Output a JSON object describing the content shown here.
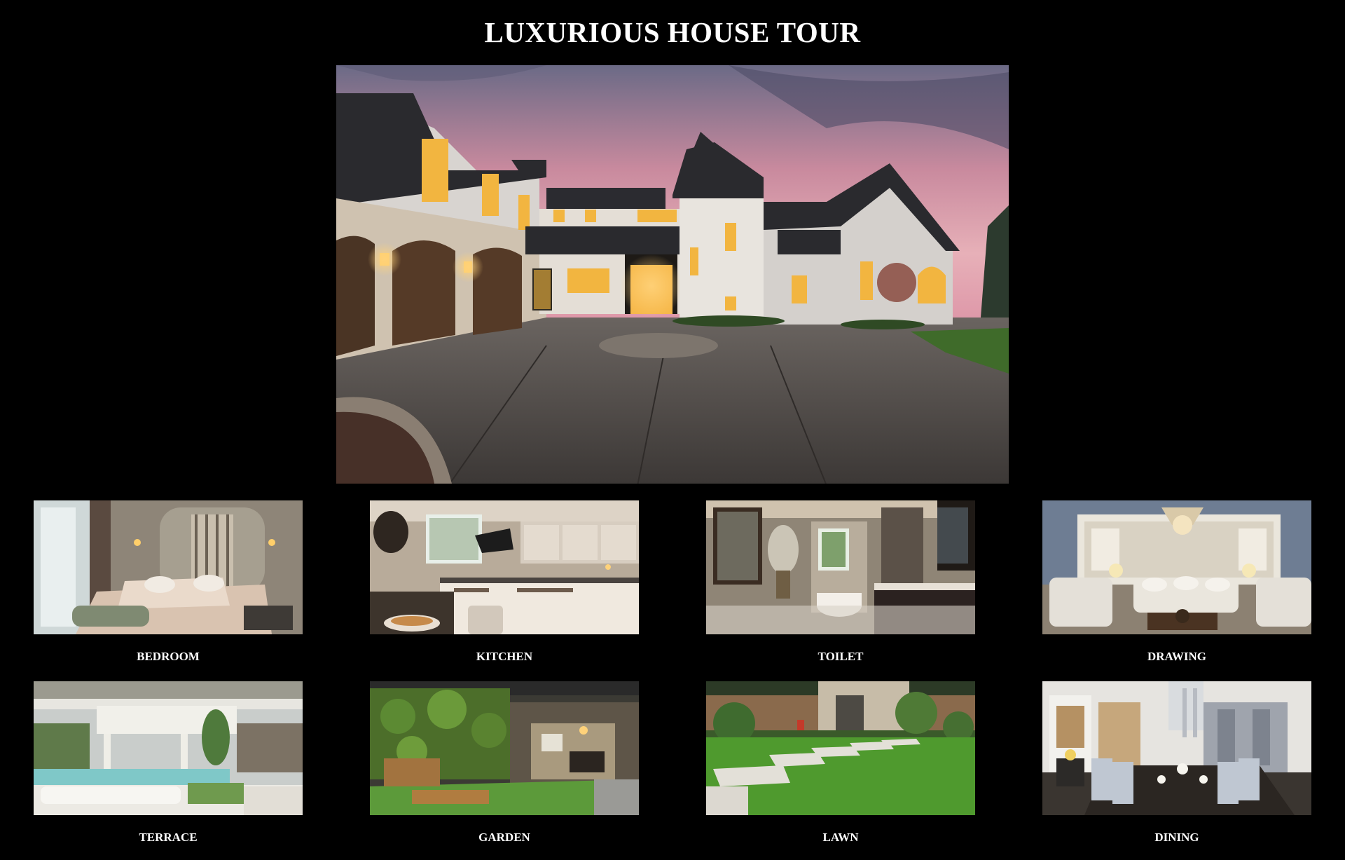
{
  "page": {
    "title": "LUXURIOUS HOUSE TOUR"
  },
  "hero": {
    "image": "house-exterior-at-dusk"
  },
  "rooms": [
    {
      "label": "BEDROOM",
      "image": "bedroom-photo"
    },
    {
      "label": "KITCHEN",
      "image": "kitchen-photo"
    },
    {
      "label": "TOILET",
      "image": "bathroom-photo"
    },
    {
      "label": "DRAWING",
      "image": "drawing-room-photo"
    },
    {
      "label": "TERRACE",
      "image": "terrace-photo"
    },
    {
      "label": "GARDEN",
      "image": "garden-photo"
    },
    {
      "label": "LAWN",
      "image": "lawn-photo"
    },
    {
      "label": "DINING",
      "image": "dining-room-photo"
    }
  ],
  "colors": {
    "background": "#000000",
    "text": "#ffffff"
  }
}
